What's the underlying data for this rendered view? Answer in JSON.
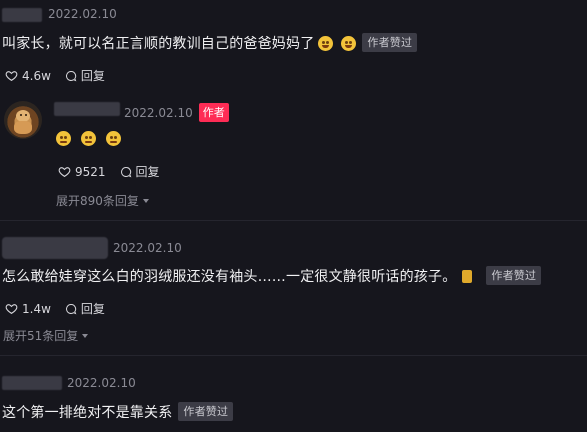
{
  "comments": [
    {
      "date": "2022.02.10",
      "text": "叫家长，就可以名正言顺的教训自己的爸爸妈妈了",
      "badge": "作者赞过",
      "likes": "4.6w",
      "reply": "回复"
    },
    {
      "date": "2022.02.10",
      "author_tag": "作者",
      "likes": "9521",
      "reply": "回复",
      "expand": "展开890条回复"
    },
    {
      "date": "2022.02.10",
      "text": "怎么敢给娃穿这么白的羽绒服还没有袖头……一定很文静很听话的孩子。",
      "badge": "作者赞过",
      "likes": "1.4w",
      "reply": "回复",
      "expand": "展开51条回复"
    },
    {
      "date": "2022.02.10",
      "text": "这个第一排绝对不是靠关系",
      "badge": "作者赞过"
    }
  ],
  "colors": {
    "background": "#16161d",
    "author_tag": "#fe2c55",
    "badge_bg": "#3c3c46"
  },
  "icons": [
    "heart-icon",
    "comment-icon",
    "laughing-emoji",
    "pleading-emoji",
    "caret-down-icon"
  ]
}
